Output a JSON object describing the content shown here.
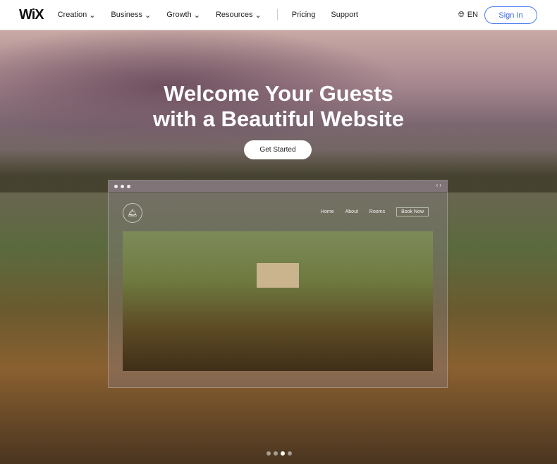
{
  "nav": {
    "logo": "WiX",
    "items": [
      {
        "label": "Creation"
      },
      {
        "label": "Business"
      },
      {
        "label": "Growth"
      },
      {
        "label": "Resources"
      }
    ],
    "links": [
      "Pricing",
      "Support"
    ],
    "language": "EN",
    "sign_in": "Sign In"
  },
  "hero": {
    "title_line1": "Welcome Your Guests",
    "title_line2": "with a Beautiful Website",
    "cta": "Get Started"
  },
  "mock_site": {
    "nav": [
      "Home",
      "About",
      "Rooms"
    ],
    "book": "Book Now"
  },
  "carousel": {
    "slides": 4,
    "active": 3
  },
  "colors": {
    "accent": "#3868e8"
  }
}
